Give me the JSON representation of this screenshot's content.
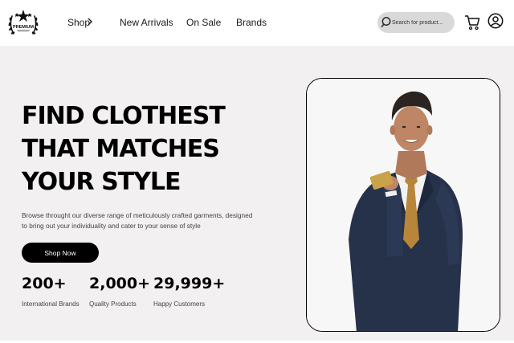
{
  "nav": {
    "logo_text": "PREMIUM",
    "shop_label": "Shop",
    "new_arrivals_label": "New Arrivals",
    "on_sale_label": "On Sale",
    "brands_label": "Brands"
  },
  "search": {
    "placeholder": "Search for product..."
  },
  "hero": {
    "headline_line1": "FIND CLOTHEST",
    "headline_line2": "THAT MATCHES",
    "headline_line3": "YOUR STYLE",
    "description": "Browse throught our diverse range of meticulously crafted garments, designed to bring out your individuality and cater to your sense of style",
    "cta_label": "Shop Now"
  },
  "stats": [
    {
      "value": "200+",
      "label": "International Brands"
    },
    {
      "value": "2,000+",
      "label": "Quality Products"
    },
    {
      "value": "29,999+",
      "label": "Happy Customers"
    }
  ],
  "colors": {
    "hero_background": "#f2f0f1",
    "accent": "#000000",
    "search_background": "#d9d9d9"
  }
}
